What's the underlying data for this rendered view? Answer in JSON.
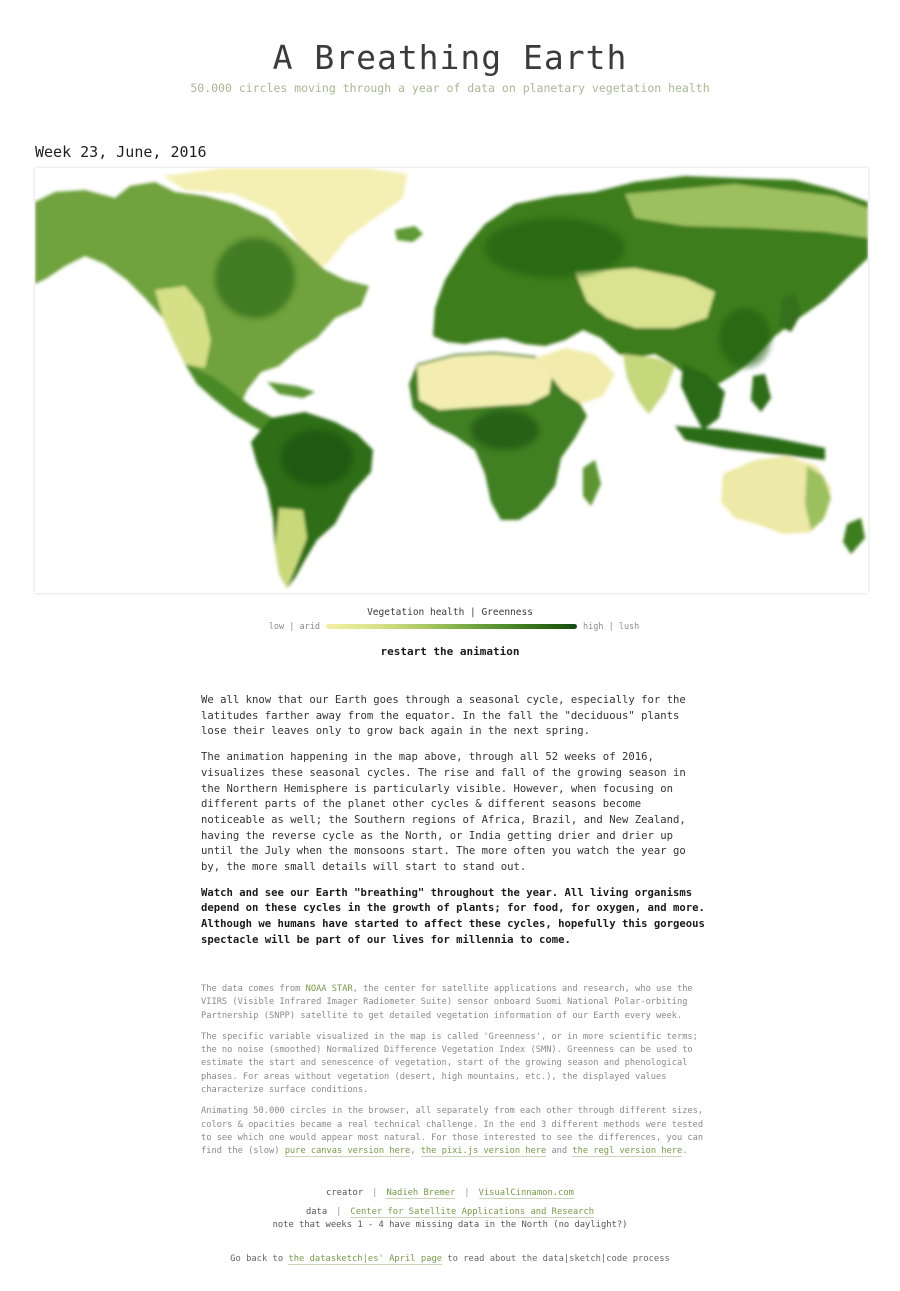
{
  "header": {
    "title": "A Breathing Earth",
    "subtitle": "50.000 circles moving through a year of data on planetary vegetation health"
  },
  "week_label": "Week 23, June, 2016",
  "legend": {
    "title": "Vegetation health | Greenness",
    "low": "low | arid",
    "high": "high | lush",
    "colors": [
      "#f3eea3",
      "#d8e28a",
      "#a9c865",
      "#6fa23e",
      "#3b7a1e",
      "#154a0c"
    ]
  },
  "restart_label": "restart the animation",
  "intro": {
    "p1": "We all know that our Earth goes through a seasonal cycle, especially for the latitudes farther away from the equator. In the fall the \"deciduous\" plants lose their leaves only to grow back again in the next spring.",
    "p2": "The animation happening in the map above, through all 52 weeks of 2016, visualizes these seasonal cycles. The rise and fall of the growing season in the Northern Hemisphere is particularly visible. However, when focusing on different parts of the planet other cycles & different seasons become noticeable as well; the Southern regions of Africa, Brazil, and New Zealand, having the reverse cycle as the North, or India getting drier and drier up until the July when the monsoons start. The more often you watch the year go by, the more small details will start to stand out.",
    "p3": "Watch and see our Earth \"breathing\" throughout the year. All living organisms depend on these cycles in the growth of plants; for food, for oxygen, and more. Although we humans have started to affect these cycles, hopefully this gorgeous spectacle will be part of our lives for millennia to come."
  },
  "notes": {
    "n1_pre": "The data comes from ",
    "n1_link": "NOAA STAR",
    "n1_post": ", the center for satellite applications and research, who use the VIIRS (Visible Infrared Imager Radiometer Suite) sensor onboard Suomi National Polar-orbiting Partnership (SNPP) satellite to get detailed vegetation information of our Earth every week.",
    "n2": "The specific variable visualized in the map is called 'Greenness', or in more scientific terms; the no noise (smoothed) Normalized Difference Vegetation Index (SMN). Greenness can be used to estimate the start and senescence of vegetation, start of the growing season and phenological phases. For areas without vegetation (desert, high mountains, etc.), the displayed values characterize surface conditions.",
    "n3_pre": "Animating 50.000 circles in the browser, all separately from each other through different sizes, colors & opacities became a real technical challenge. In the end 3 different methods were tested to see which one would appear most natural. For those interested to see the differences, you can find the (slow) ",
    "n3_link1": "pure canvas version here",
    "n3_sep": ", ",
    "n3_link2": "the pixi.js version here",
    "n3_and": " and ",
    "n3_link3": "the regl version here",
    "n3_end": "."
  },
  "credits": {
    "creator_label": "creator",
    "creator_name": "Nadieh Bremer",
    "creator_site": "VisualCinnamon.com",
    "data_label": "data",
    "data_source": "Center for Satellite Applications and Research",
    "note": "note that weeks 1 - 4 have missing data in the North (no daylight?)"
  },
  "footer": {
    "pre": "Go back to ",
    "link": "the datasketch|es' April page",
    "post": " to read about the data|sketch|code process"
  }
}
